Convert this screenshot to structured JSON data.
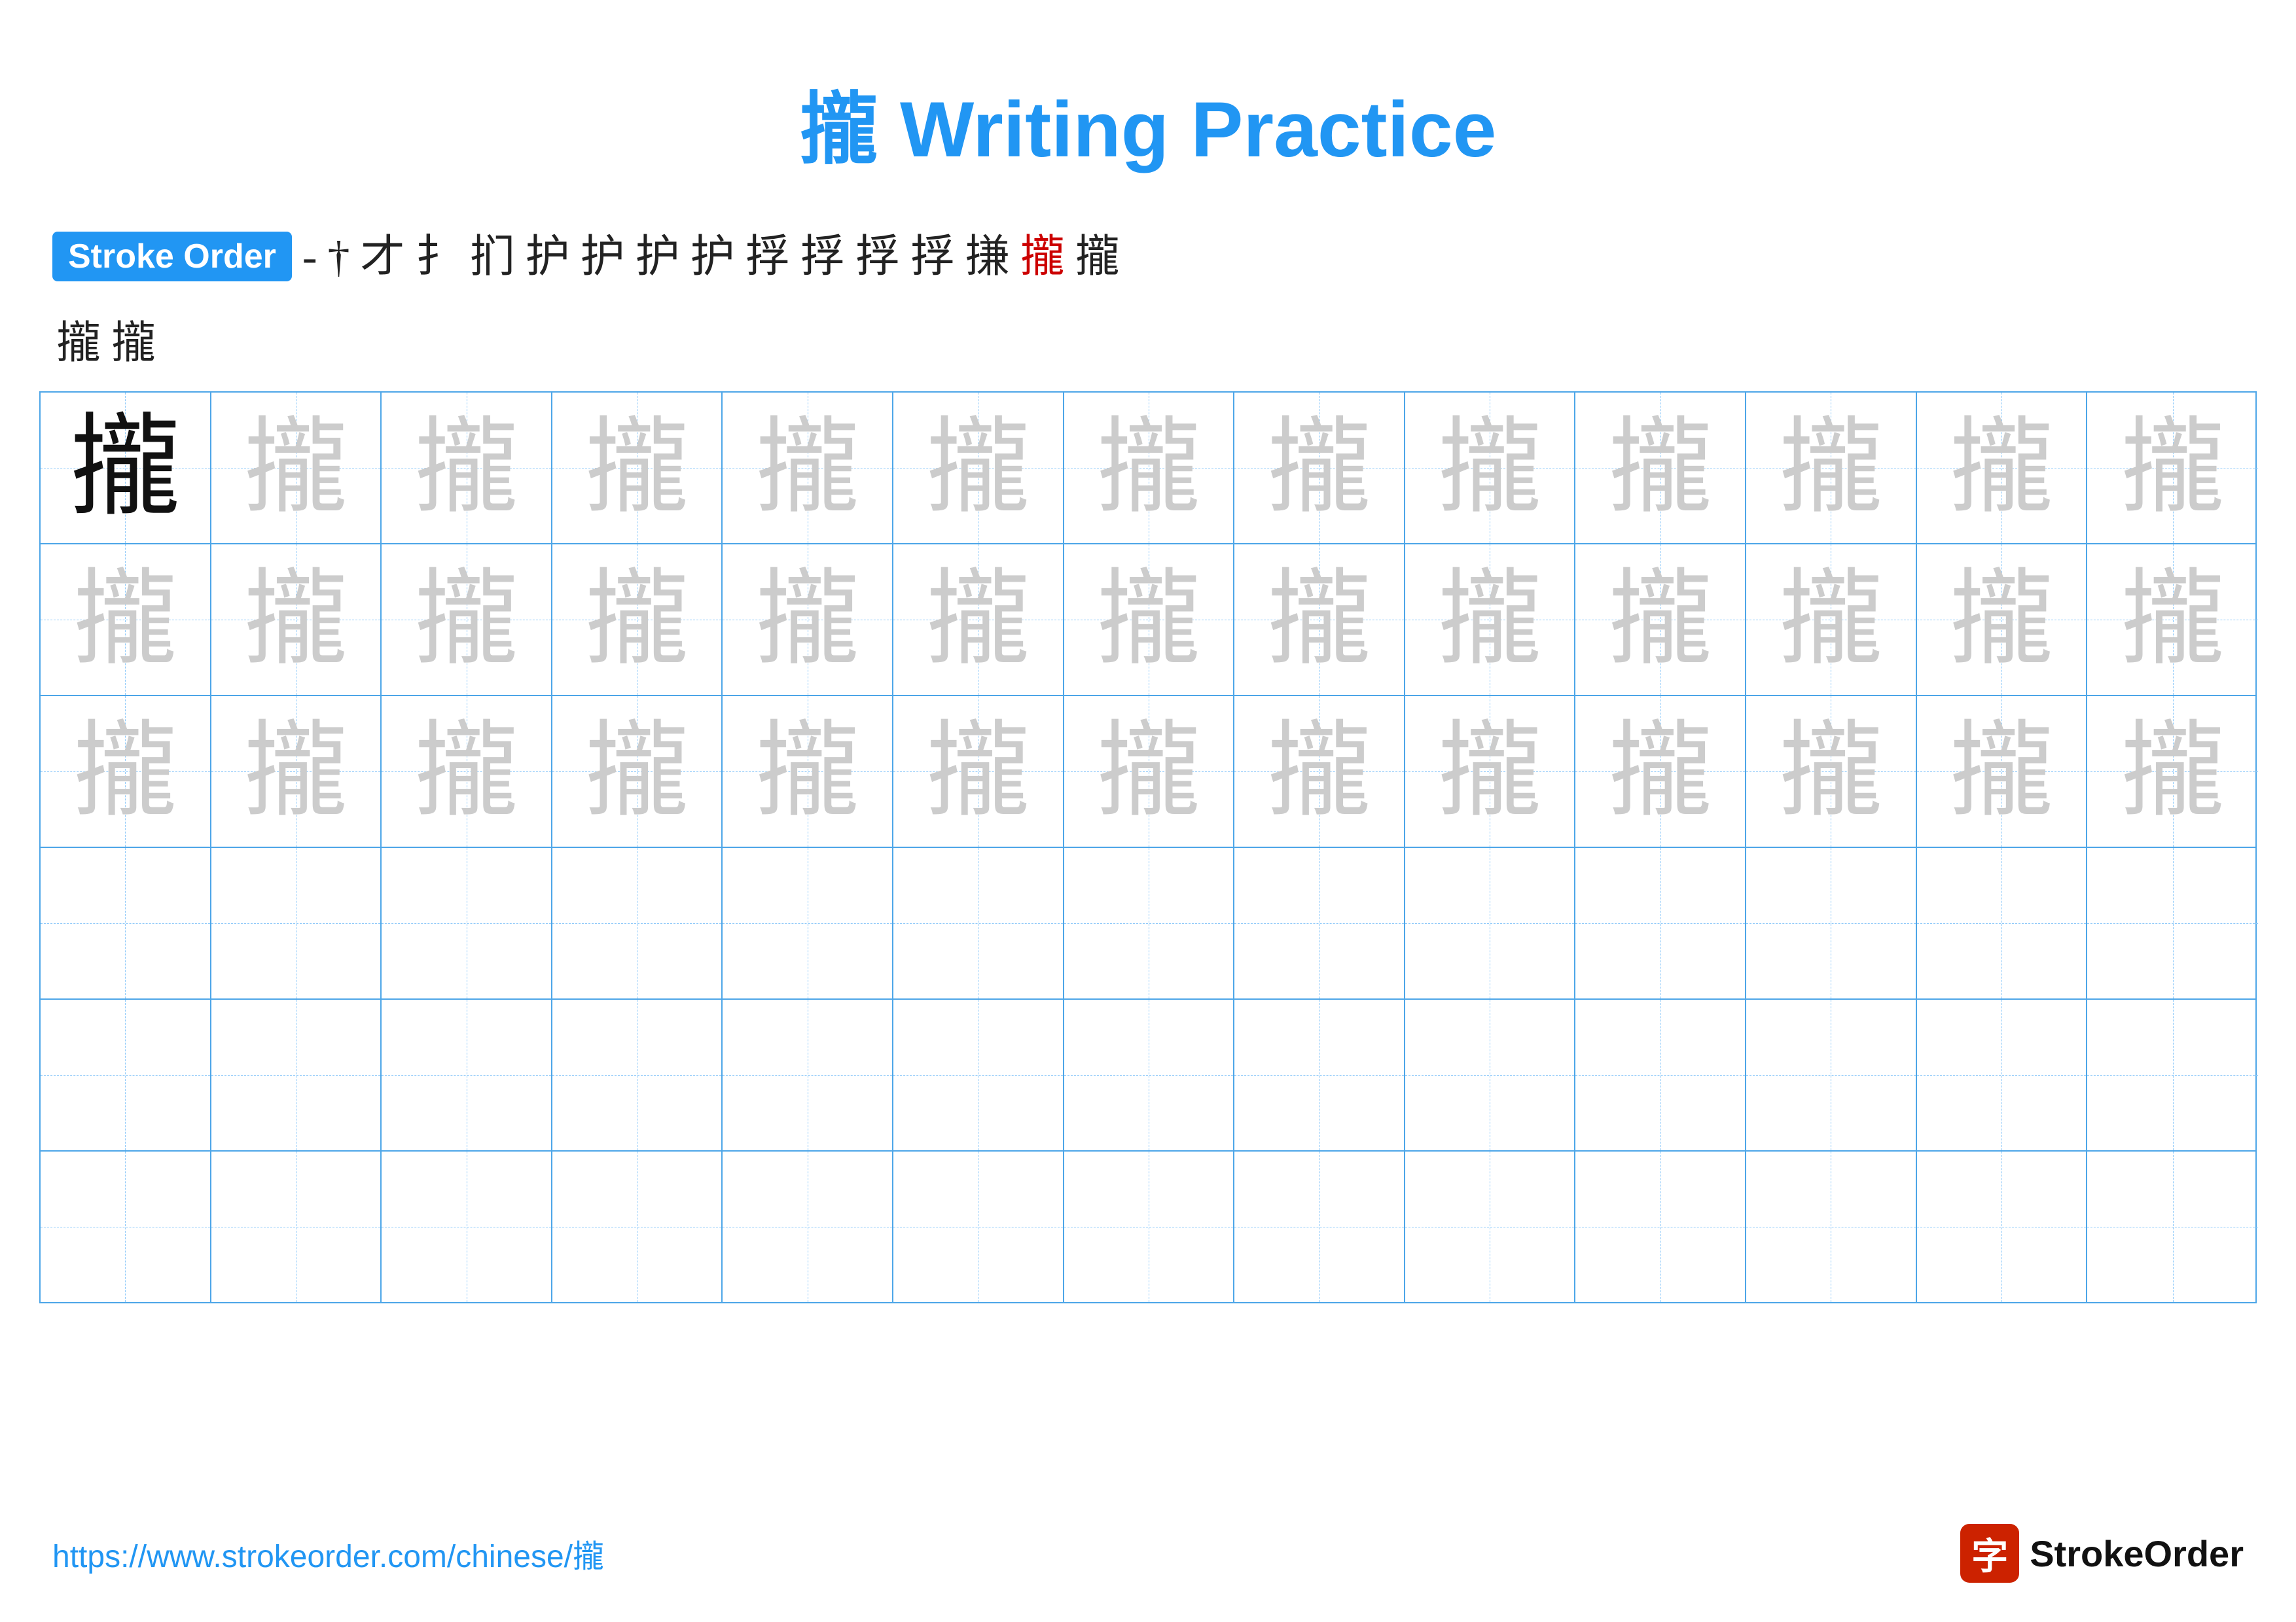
{
  "title": {
    "char": "攏",
    "text": " Writing Practice"
  },
  "stroke_order": {
    "badge_label": "Stroke Order",
    "strokes_row1": [
      "-",
      "†",
      "才",
      "扌",
      "扪",
      "护",
      "护",
      "护",
      "护",
      "捊",
      "捊",
      "捊",
      "捊",
      "搛",
      "攏",
      "攏"
    ],
    "strokes_row2": [
      "攏",
      "攏"
    ]
  },
  "grid": {
    "rows": 6,
    "cols": 13,
    "char": "攏",
    "faded_rows": 3,
    "empty_rows": 3
  },
  "footer": {
    "link": "https://www.strokeorder.com/chinese/攏",
    "logo_icon": "字",
    "logo_text": "StrokeOrder"
  }
}
